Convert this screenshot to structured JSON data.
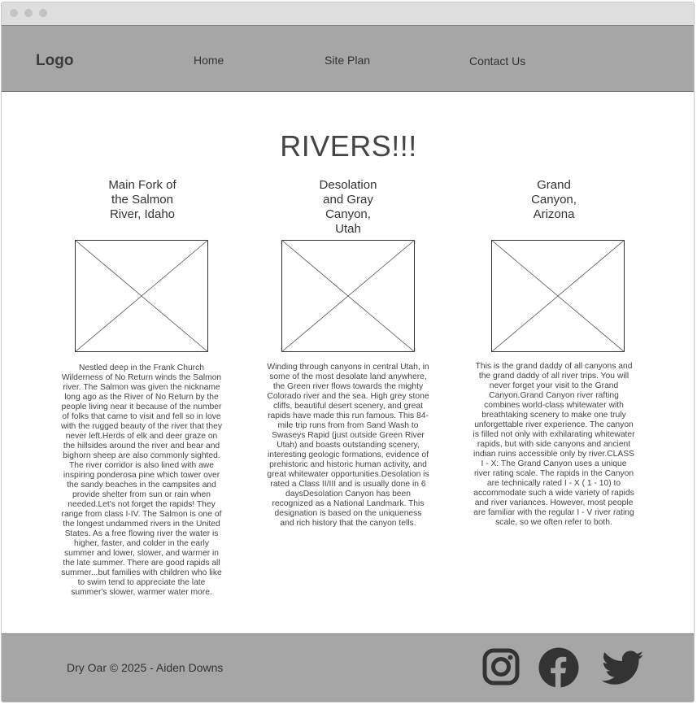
{
  "header": {
    "logo": "Logo",
    "nav": [
      "Home",
      "Site Plan",
      "Contact Us"
    ]
  },
  "main": {
    "title": "RIVERS!!!",
    "columns": [
      {
        "heading": "Main Fork of the Salmon River, Idaho",
        "text": "Nestled deep in the Frank Church Wilderness of No Return winds the Salmon river. The Salmon was given the nickname long ago as the River of No Return by the people living near it because of the number of folks that came to visit and fell so in love with the rugged beauty of the river that they never left.Herds of elk and deer graze on the hillsides around the river and bear and bighorn sheep are also commonly sighted. The river corridor is also lined with awe inspiring ponderosa pine which tower over the sandy beaches in the campsites and provide shelter from sun or rain when needed.Let's not forget the rapids! They range from class I-IV. The Salmon is one of the longest undammed rivers in the United States. As a free flowing river the water is higher, faster, and colder in the early summer and lower, slower, and warmer in the late summer. There are good rapids all summer...but families with children who like to swim tend to appreciate the late summer's slower, warmer water more."
      },
      {
        "heading": "Desolation and Gray Canyon, Utah",
        "text": "Winding through canyons in central Utah, in some of the most desolate land anywhere, the Green river flows towards the mighty Colorado river and the sea. High grey stone cliffs, beautiful desert scenery, and great rapids have made this run famous. This 84-mile trip runs from from Sand Wash to Swaseys Rapid (just outside Green River Utah) and boasts outstanding scenery, interesting geologic formations, evidence of prehistoric and historic human activity, and great whitewater opportunities.Desolation is rated a Class II/III and is usually done in 6 daysDesolation Canyon has been recognized as a National Landmark.  This designation is based on the uniqueness and rich history that the canyon tells."
      },
      {
        "heading": "Grand Canyon, Arizona",
        "text": "This is the grand daddy of all canyons and the grand daddy of all river trips. You will never forget your visit to the Grand Canyon.Grand Canyon river rafting combines world-class whitewater with breathtaking scenery to make one truly unforgettable river experience. The canyon is filled not only with exhilarating whitewater rapids, but with side canyons and ancient indian ruins accessible only by river.CLASS I - X: The Grand Canyon uses a unique river rating scale. The rapids in the Canyon are technically rated I - X ( 1 - 10) to accommodate such a wide variety of rapids and river variances. However, most people are familiar with the regular I - V river rating scale, so we often refer to both."
      }
    ]
  },
  "footer": {
    "copyright": "Dry Oar © 2025 - Aiden Downs",
    "social": [
      "instagram-icon",
      "facebook-icon",
      "twitter-icon"
    ]
  },
  "colors": {
    "bar": "#a6a6a6",
    "icon": "#333333"
  }
}
